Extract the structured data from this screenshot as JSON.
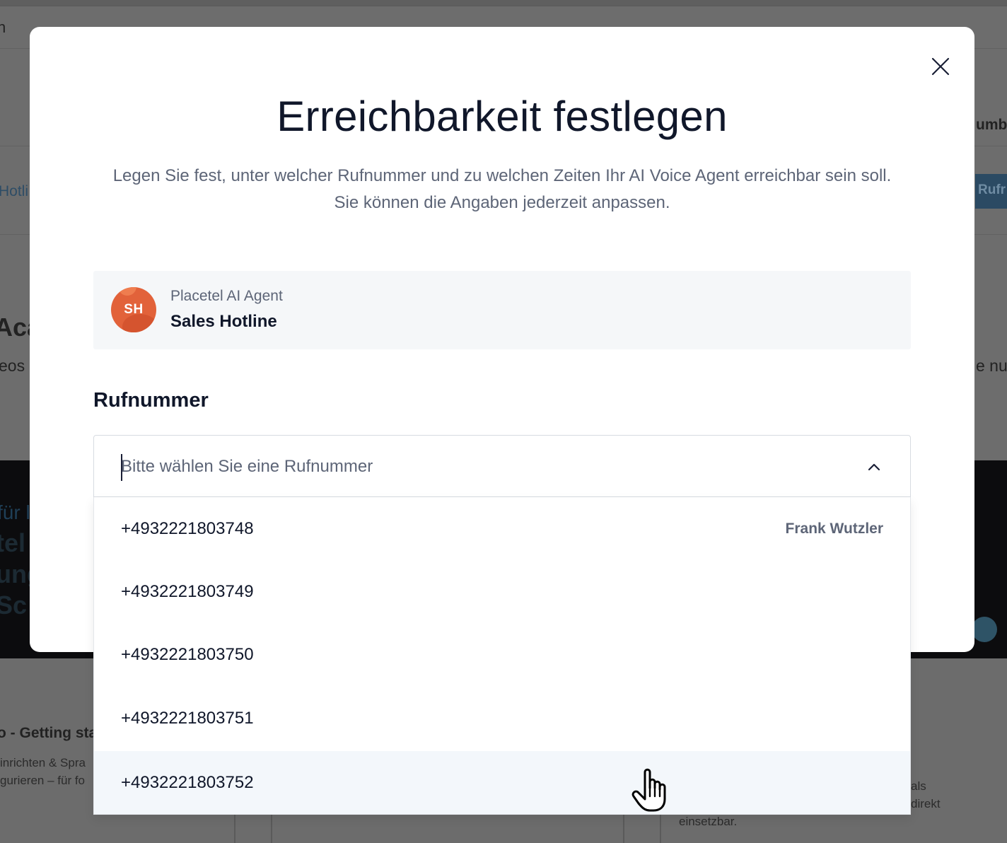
{
  "background": {
    "fragments": [
      "n",
      "umbe",
      "Hotli",
      "Rufr",
      "Aca",
      "eos",
      "e nut",
      "für l",
      "tel",
      "ung",
      "Sc",
      "o - Getting sta",
      "inrichten & Spra",
      "gurieren – für fo",
      "als",
      "direkt",
      "einsetzbar."
    ]
  },
  "modal": {
    "close_icon": "close-icon",
    "title": "Erreichbarkeit festlegen",
    "description_line1": "Legen Sie fest, unter welcher Rufnummer und zu welchen Zeiten Ihr AI Voice Agent erreichbar sein soll.",
    "description_line2": "Sie können die Angaben jederzeit anpassen.",
    "agent": {
      "initials": "SH",
      "type": "Placetel AI Agent",
      "name": "Sales Hotline",
      "avatar_color": "#e2623a"
    },
    "phone_section": {
      "label": "Rufnummer",
      "placeholder": "Bitte wählen Sie eine Rufnummer",
      "value": "",
      "chevron_icon": "chevron-up-icon",
      "options": [
        {
          "number": "+4932221803748",
          "owner": "Frank Wutzler"
        },
        {
          "number": "+4932221803749",
          "owner": ""
        },
        {
          "number": "+4932221803750",
          "owner": ""
        },
        {
          "number": "+4932221803751",
          "owner": ""
        },
        {
          "number": "+4932221803752",
          "owner": ""
        }
      ],
      "hovered_index": 4
    }
  },
  "colors": {
    "title": "#10172a",
    "muted": "#5d6577",
    "hover_row": "#f3f7fb",
    "card_bg": "#f5f7f9"
  }
}
